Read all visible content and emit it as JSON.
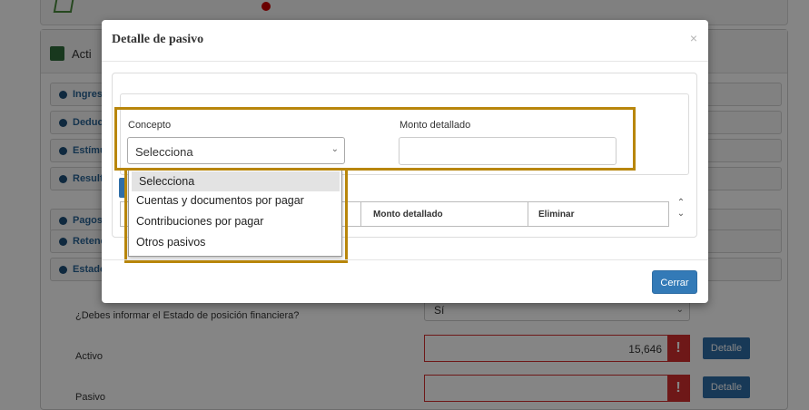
{
  "background": {
    "section_title": "Acti",
    "accordion": [
      {
        "label": "Ingres"
      },
      {
        "label": "Deduc"
      },
      {
        "label": "Estímu"
      },
      {
        "label": "Result"
      },
      {
        "label": "Pagos"
      },
      {
        "label": "Retenc"
      },
      {
        "label": "Estado"
      }
    ],
    "question": "¿Debes informar el Estado de posición financiera?",
    "question_answer": "Sí",
    "activo_label": "Activo",
    "activo_value": "15,646",
    "pasivo_label": "Pasivo",
    "pasivo_value": "",
    "detalle_label": "Detalle",
    "warn_glyph": "!"
  },
  "modal": {
    "title": "Detalle de pasivo",
    "close_glyph": "×",
    "concepto_label": "Concepto",
    "monto_label": "Monto detallado",
    "concepto_selected": "Selecciona",
    "monto_value": "",
    "monto_placeholder": "",
    "table_headers": {
      "monto": "Monto detallado",
      "eliminar": "Eliminar"
    },
    "dropdown_options": [
      "Selecciona",
      "Cuentas y documentos por pagar",
      "Contribuciones por pagar",
      "Otros pasivos"
    ],
    "close_button": "Cerrar"
  },
  "colors": {
    "highlight": "#b8860b",
    "primary": "#337ab7",
    "error": "#d32f2f"
  }
}
